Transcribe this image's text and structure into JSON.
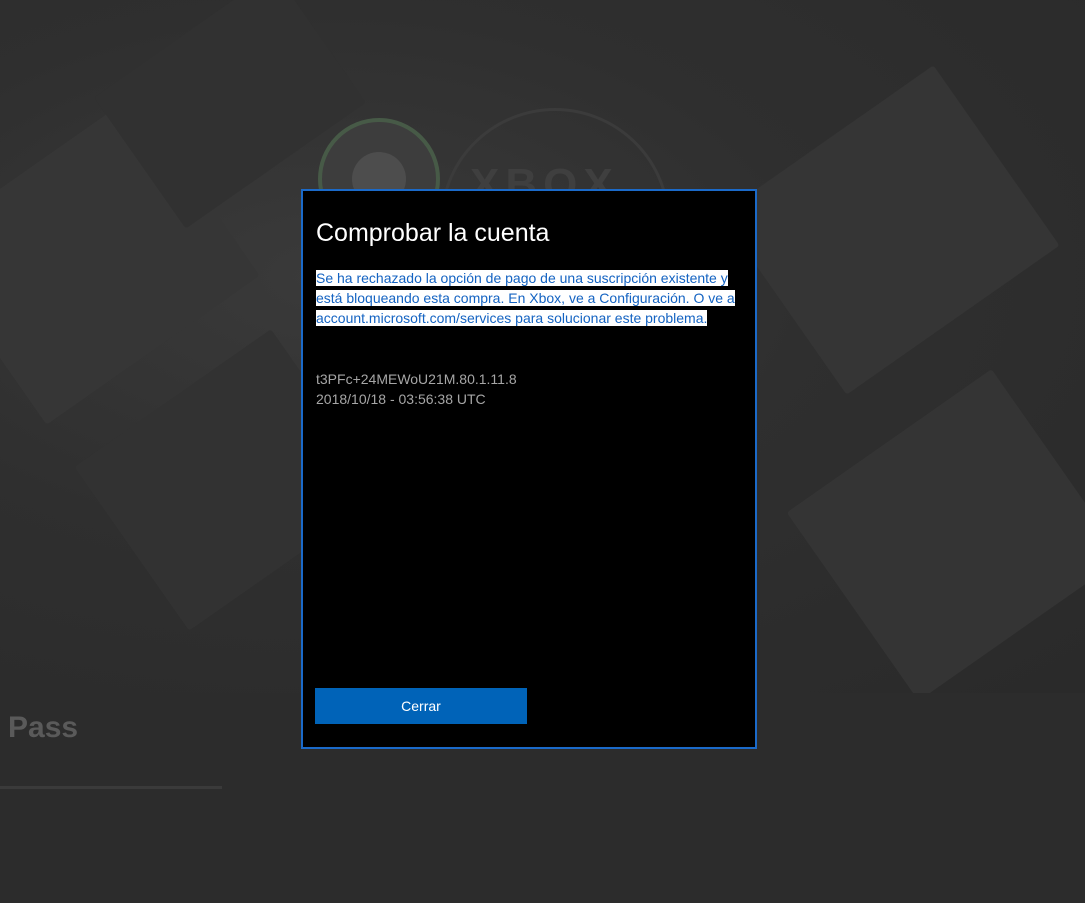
{
  "background": {
    "logo_wordmark": "XBOX",
    "section_title": "Pass"
  },
  "dialog": {
    "title": "Comprobar la cuenta",
    "message": "Se ha rechazado la opción de pago de una suscripción existente y está bloqueando esta compra. En Xbox, ve a Configuración. O ve a account.microsoft.com/services para solucionar este problema.",
    "error_code": "t3PFc+24MEWoU21M.80.1.11.8",
    "timestamp": "2018/10/18 - 03:56:38 UTC",
    "close_label": "Cerrar"
  },
  "colors": {
    "accent": "#0063b8",
    "dialog_border": "#1b6ac9",
    "highlight_text": "#1463c2"
  }
}
